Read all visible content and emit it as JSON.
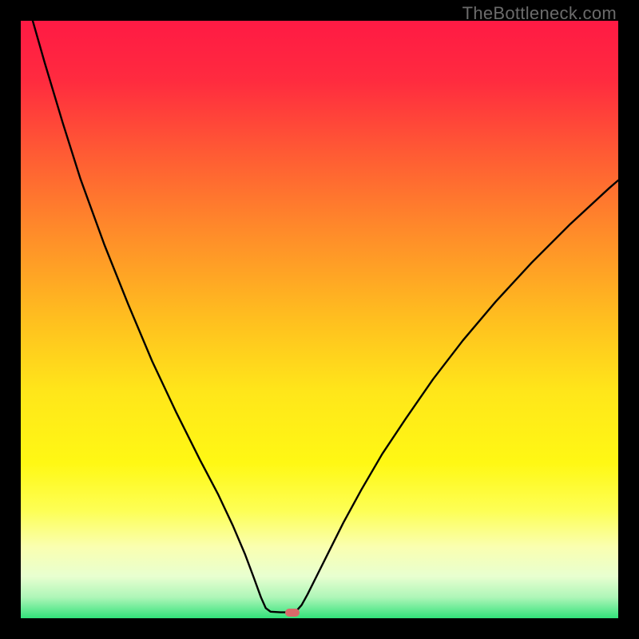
{
  "watermark": {
    "text": "TheBottleneck.com"
  },
  "chart_data": {
    "type": "line",
    "title": "",
    "xlabel": "",
    "ylabel": "",
    "xlim": [
      0,
      100
    ],
    "ylim": [
      0,
      100
    ],
    "background_gradient": {
      "stops": [
        {
          "offset": 0.0,
          "color": "#ff1a44"
        },
        {
          "offset": 0.1,
          "color": "#ff2b3f"
        },
        {
          "offset": 0.22,
          "color": "#ff5a34"
        },
        {
          "offset": 0.35,
          "color": "#ff8a2a"
        },
        {
          "offset": 0.5,
          "color": "#ffbf1f"
        },
        {
          "offset": 0.62,
          "color": "#ffe61a"
        },
        {
          "offset": 0.74,
          "color": "#fff814"
        },
        {
          "offset": 0.82,
          "color": "#fdff55"
        },
        {
          "offset": 0.88,
          "color": "#faffb0"
        },
        {
          "offset": 0.93,
          "color": "#e8ffd0"
        },
        {
          "offset": 0.965,
          "color": "#aef6b8"
        },
        {
          "offset": 1.0,
          "color": "#32e27a"
        }
      ]
    },
    "series": [
      {
        "name": "bottleneck-curve",
        "color": "#000000",
        "width": 2.4,
        "points": [
          {
            "x": 2.0,
            "y": 100.0
          },
          {
            "x": 4.0,
            "y": 93.0
          },
          {
            "x": 7.0,
            "y": 83.0
          },
          {
            "x": 10.0,
            "y": 73.5
          },
          {
            "x": 14.0,
            "y": 62.5
          },
          {
            "x": 18.0,
            "y": 52.5
          },
          {
            "x": 22.0,
            "y": 43.0
          },
          {
            "x": 26.0,
            "y": 34.5
          },
          {
            "x": 30.0,
            "y": 26.5
          },
          {
            "x": 33.0,
            "y": 20.8
          },
          {
            "x": 35.5,
            "y": 15.5
          },
          {
            "x": 37.5,
            "y": 10.8
          },
          {
            "x": 39.0,
            "y": 6.8
          },
          {
            "x": 40.2,
            "y": 3.5
          },
          {
            "x": 41.0,
            "y": 1.7
          },
          {
            "x": 41.8,
            "y": 1.1
          },
          {
            "x": 43.5,
            "y": 1.0
          },
          {
            "x": 45.2,
            "y": 1.0
          },
          {
            "x": 46.2,
            "y": 1.3
          },
          {
            "x": 47.0,
            "y": 2.2
          },
          {
            "x": 48.0,
            "y": 4.0
          },
          {
            "x": 49.5,
            "y": 7.0
          },
          {
            "x": 51.5,
            "y": 11.0
          },
          {
            "x": 54.0,
            "y": 16.0
          },
          {
            "x": 57.0,
            "y": 21.5
          },
          {
            "x": 60.5,
            "y": 27.5
          },
          {
            "x": 64.5,
            "y": 33.5
          },
          {
            "x": 69.0,
            "y": 40.0
          },
          {
            "x": 74.0,
            "y": 46.5
          },
          {
            "x": 79.5,
            "y": 53.0
          },
          {
            "x": 85.5,
            "y": 59.5
          },
          {
            "x": 92.0,
            "y": 66.0
          },
          {
            "x": 98.5,
            "y": 72.0
          },
          {
            "x": 100.0,
            "y": 73.3
          }
        ]
      }
    ],
    "marker": {
      "x": 45.4,
      "y": 1.0,
      "color": "#d96a6a"
    }
  }
}
